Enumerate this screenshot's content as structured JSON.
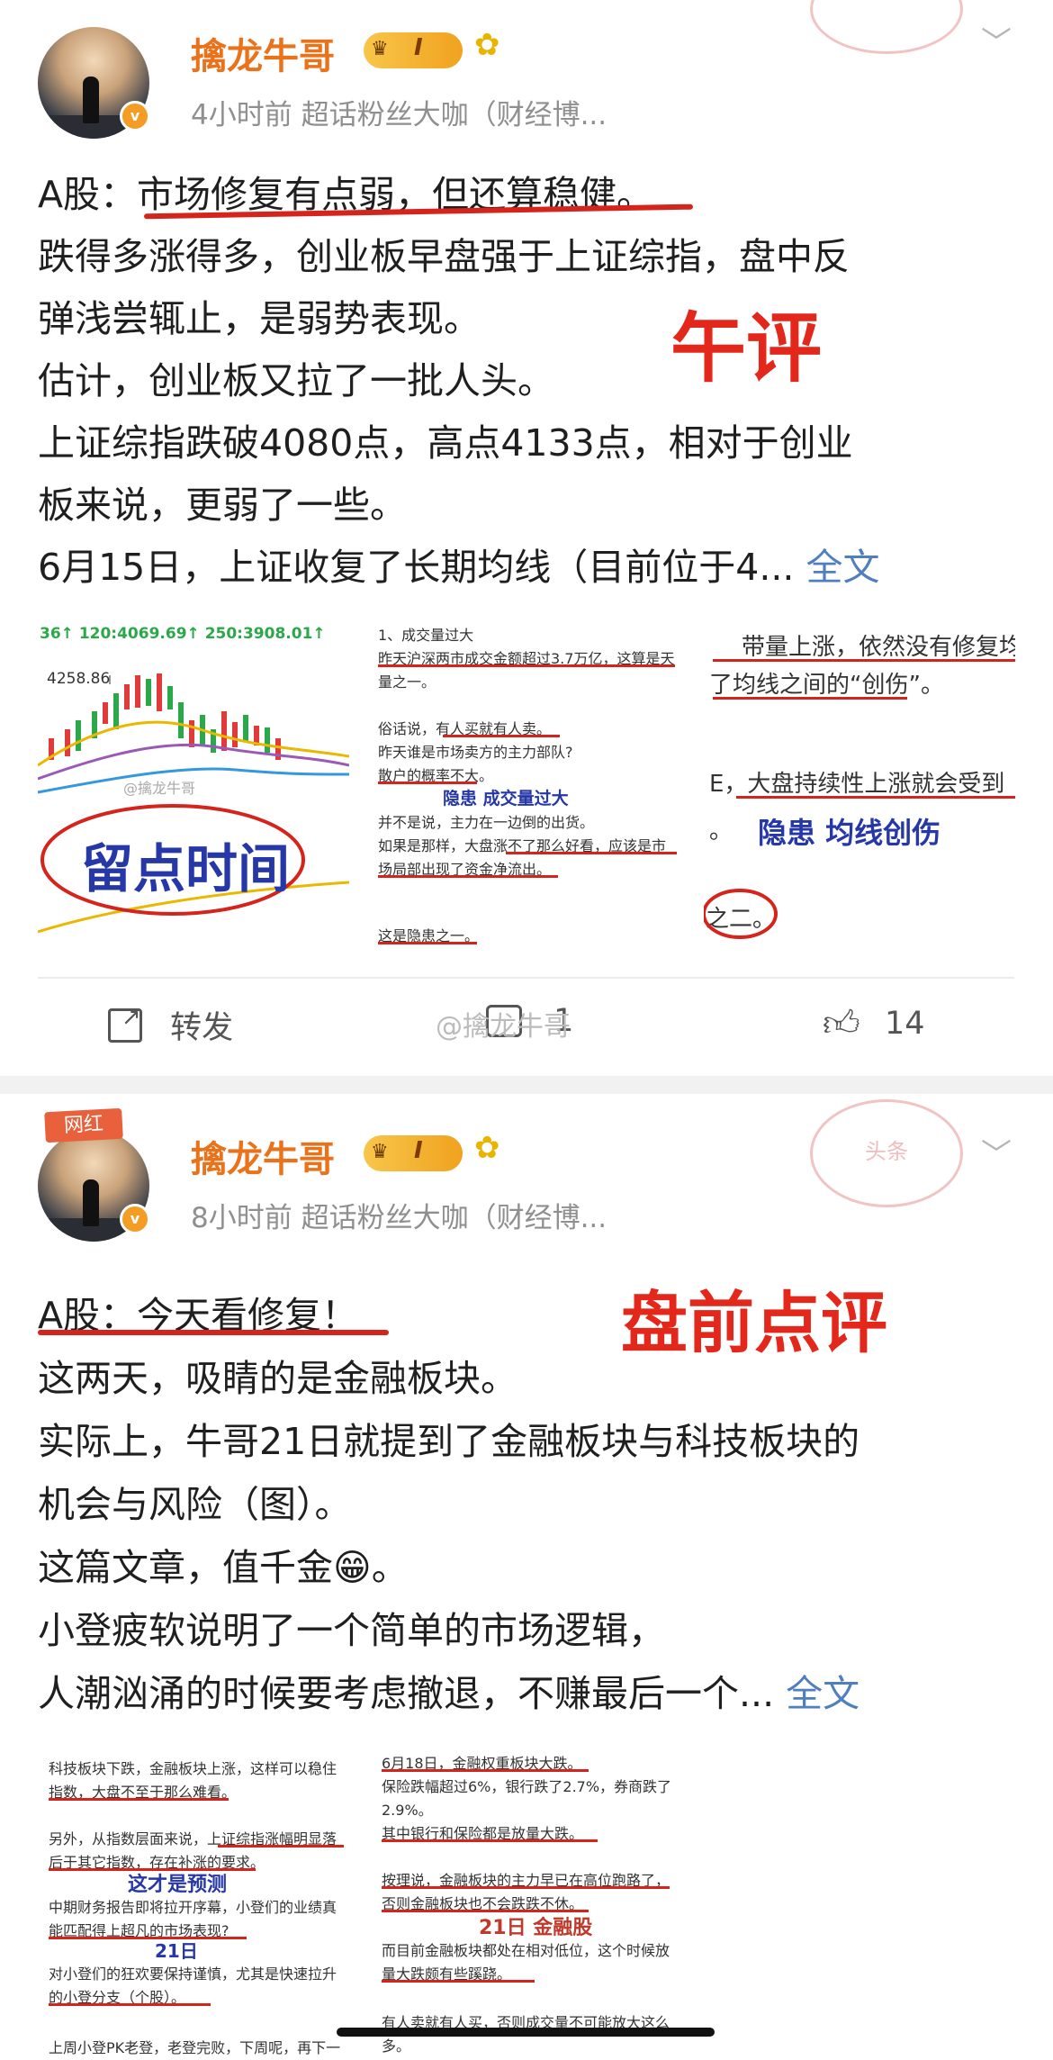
{
  "post1": {
    "author": "擒龙牛哥",
    "level_badge": "I",
    "meta": "4小时前  超话粉丝大咖（财经博...",
    "lines": [
      "A股：市场修复有点弱，但还算稳健。",
      "跌得多涨得多，创业板早盘强于上证综指，盘中反",
      "弹浅尝辄止，是弱势表现。",
      "估计，创业板又拉了一批人头。",
      "上证综指跌破4080点，高点4133点，相对于创业",
      "板来说，更弱了一些。",
      "6月15日，上证收复了长期均线（目前位于4... "
    ],
    "more": "全文",
    "red_mark": "午评",
    "img1": {
      "top_text": "36↑ 120:4069.69↑ 250:3908.01↑",
      "price_label": "4258.86",
      "watermark": "@擒龙牛哥",
      "caption": "留点时间"
    },
    "img2": {
      "lines": [
        "1、成交量过大",
        "昨天沪深两市成交金额超过3.7万亿，这算是天",
        "量之一。",
        "",
        "俗话说，有人买就有人卖。",
        "昨天谁是市场卖方的主力部队?",
        "散户的概率不大。",
        "隐患  成交量过大",
        "并不是说，主力在一边倒的出货。",
        "如果是那样，大盘涨不了那么好看，应该是市",
        "场局部出现了资金净流出。",
        "",
        "这是隐患之一。"
      ]
    },
    "img3": {
      "line1": "带量上涨，依然没有修复均",
      "line2": "了均线之间的“创伤”。",
      "line3": "E，大盘持续性上涨就会受到",
      "line4": "。",
      "caption": "隐患 均线创伤",
      "line5": "之二。"
    },
    "actions": {
      "repost": "转发",
      "comment_count": "1",
      "like_count": "14"
    },
    "watermark": "@擒龙牛哥"
  },
  "post2": {
    "tag": "网红",
    "author": "擒龙牛哥",
    "level_badge": "I",
    "meta": "8小时前  超话粉丝大咖（财经博...",
    "stamp": "头条",
    "lines": [
      "A股：今天看修复！",
      "这两天，吸睛的是金融板块。",
      "实际上，牛哥21日就提到了金融板块与科技板块的",
      "机会与风险（图）。",
      "这篇文章，值千金😁。",
      "小登疲软说明了一个简单的市场逻辑，",
      "人潮汹涌的时候要考虑撤退，不赚最后一个... "
    ],
    "more": "全文",
    "red_mark": "盘前点评",
    "img1": {
      "lines": [
        "科技板块下跌，金融板块上涨，这样可以稳住",
        "指数，大盘不至于那么难看。",
        "",
        "另外，从指数层面来说，上证综指涨幅明显落",
        "后于其它指数，存在补涨的要求。",
        "这才是预测",
        "中期财务报告即将拉开序幕，小登们的业绩真",
        "能匹配得上超凡的市场表现?",
        "21日",
        "对小登们的狂欢要保持谨慎，尤其是快速拉升",
        "的小登分支（个股）。",
        "",
        "上周小登PK老登，老登完败，下周呢，再下一"
      ]
    },
    "img2": {
      "lines": [
        "6月18日，金融权重板块大跌。",
        "保险跌幅超过6%，银行跌了2.7%，券商跌了",
        "2.9%。",
        "其中银行和保险都是放量大跌。",
        "",
        "按理说，金融板块的主力早已在高位跑路了，",
        "否则金融板块也不会跌跌不休。",
        "21日 金融股",
        "而目前金融板块都处在相对低位，这个时候放",
        "量大跌颇有些蹊跷。",
        "",
        "有人卖就有人买，否则成交量不可能放大这么",
        "多。"
      ]
    }
  },
  "colors": {
    "author": "#e9721b",
    "link": "#4f7fbf",
    "mark_red": "#e3271b",
    "meta": "#8f8f8f"
  }
}
